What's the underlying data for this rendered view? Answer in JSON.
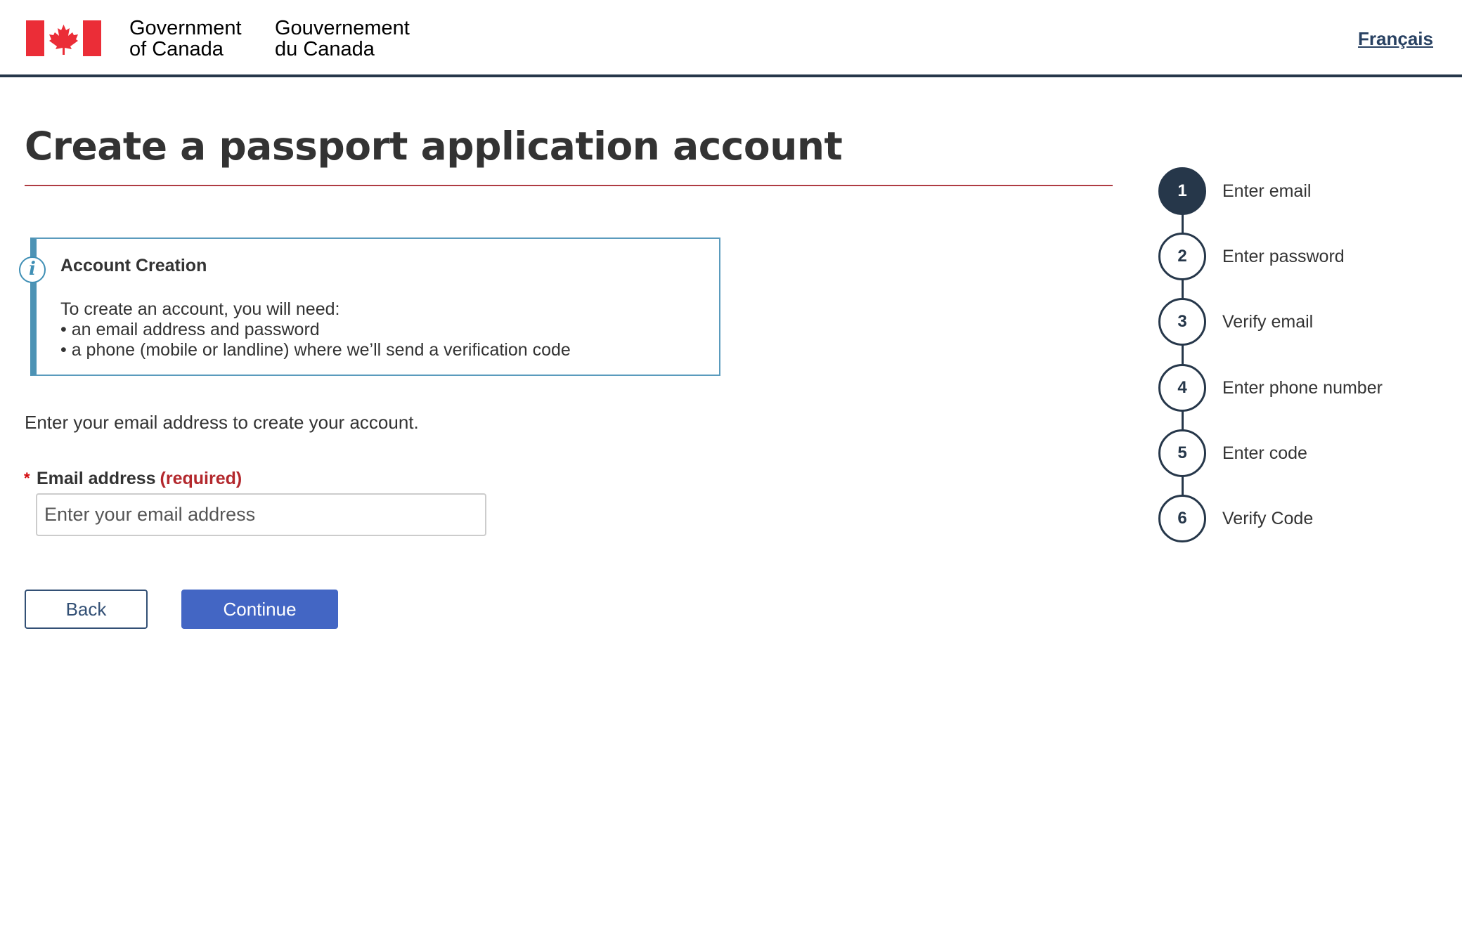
{
  "header": {
    "gov_en_line1": "Government",
    "gov_en_line2": "of Canada",
    "gov_fr_line1": "Gouvernement",
    "gov_fr_line2": "du Canada",
    "language_link": "Français",
    "flag_icon": "canada-flag-icon",
    "flag_color": "#eb2d37",
    "rule_color": "#26374a"
  },
  "main": {
    "title": "Create a passport application account",
    "title_rule_color": "#af3c43",
    "alert": {
      "icon": "info-icon",
      "title": "Account Creation",
      "line1": "To create an account, you will need:",
      "line2": "• an email address and password",
      "line3": "• a phone (mobile or landline) where we’ll send a verification code",
      "border_color": "#4d93b5"
    },
    "intro": "Enter your email address to create your account.",
    "email": {
      "required_marker": "*",
      "label": "Email address",
      "required_text": "(required)",
      "placeholder": "Enter your email address",
      "value": ""
    },
    "buttons": {
      "back_label": "Back",
      "continue_label": "Continue",
      "continue_color": "#4366c4"
    }
  },
  "stepper": {
    "active_color": "#26374a",
    "steps": [
      {
        "number": "1",
        "label": "Enter email",
        "active": true
      },
      {
        "number": "2",
        "label": "Enter password",
        "active": false
      },
      {
        "number": "3",
        "label": "Verify email",
        "active": false
      },
      {
        "number": "4",
        "label": "Enter phone number",
        "active": false
      },
      {
        "number": "5",
        "label": "Enter code",
        "active": false
      },
      {
        "number": "6",
        "label": "Verify Code",
        "active": false
      }
    ]
  }
}
